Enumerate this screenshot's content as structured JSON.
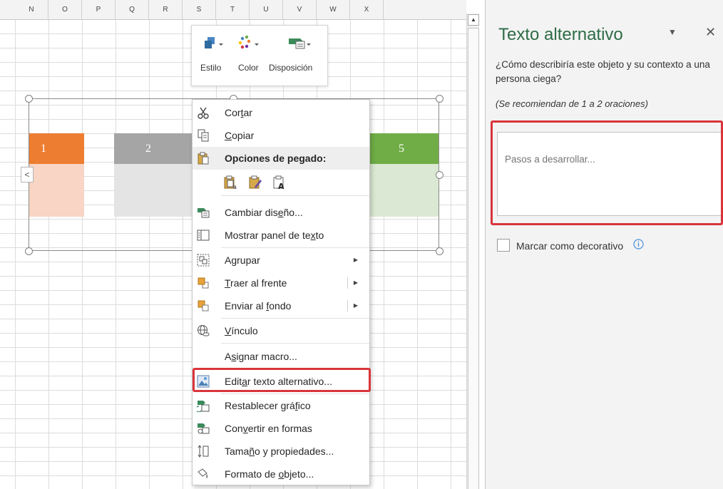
{
  "sheet": {
    "columns": [
      "N",
      "O",
      "P",
      "Q",
      "R",
      "S",
      "T",
      "U",
      "V",
      "W",
      "X"
    ]
  },
  "smartart": {
    "blocks": [
      {
        "label": "1",
        "color": "#ed7d31",
        "body_color": "#f8d5c4"
      },
      {
        "label": "2",
        "color": "#a5a5a5",
        "body_color": "#e4e4e4"
      },
      {
        "label": "5",
        "color": "#70ad47",
        "body_color": "#dbe8d3"
      }
    ],
    "expand_icon": "chevron-left-icon",
    "expand_glyph": "<"
  },
  "mini_toolbar": {
    "items": [
      {
        "label": "Estilo",
        "icon": "smartart-style-icon"
      },
      {
        "label": "Color",
        "icon": "smartart-color-icon"
      },
      {
        "label": "Disposición",
        "icon": "smartart-layout-icon"
      }
    ]
  },
  "context_menu": {
    "cut": {
      "before": "Cor",
      "mnemonic": "t",
      "after": "ar"
    },
    "copy": {
      "before": "",
      "mnemonic": "C",
      "after": "opiar"
    },
    "paste_options_header": "Opciones de pegado:",
    "change_layout": {
      "before": "Cambiar dis",
      "mnemonic": "e",
      "after": "ño..."
    },
    "text_pane": {
      "before": "Mostrar panel de te",
      "mnemonic": "x",
      "after": "to"
    },
    "group": {
      "before": "A",
      "mnemonic": "g",
      "after": "rupar"
    },
    "bring_front": {
      "before": "",
      "mnemonic": "T",
      "after": "raer al frente"
    },
    "send_back": {
      "before": "Enviar al ",
      "mnemonic": "f",
      "after": "ondo"
    },
    "link": {
      "before": "",
      "mnemonic": "V",
      "after": "ínculo"
    },
    "assign_macro": {
      "before": "A",
      "mnemonic": "s",
      "after": "ignar macro..."
    },
    "edit_alt_text": {
      "before": "Edit",
      "mnemonic": "a",
      "after": "r texto alternativo..."
    },
    "reset_graphic": {
      "before": "Restablecer grá",
      "mnemonic": "f",
      "after": "ico"
    },
    "convert_shapes": {
      "before": "Con",
      "mnemonic": "v",
      "after": "ertir en formas"
    },
    "size_props": {
      "before": "Tama",
      "mnemonic": "ñ",
      "after": "o y propiedades..."
    },
    "format_object": {
      "before": "Formato de ",
      "mnemonic": "o",
      "after": "bjeto..."
    }
  },
  "pane": {
    "title": "Texto alternativo",
    "dropdown_glyph": "▼",
    "close_glyph": "✕",
    "question": "¿Cómo describiría este objeto y su contexto a una persona ciega?",
    "hint": "(Se recomiendan de 1 a 2 oraciones)",
    "input_placeholder": "Pasos a desarrollar...",
    "input_value": "",
    "decorative_label": "Marcar como decorativo",
    "decorative_checked": false
  },
  "scrollbar": {
    "up_glyph": "▲"
  },
  "colors": {
    "accent_title": "#2e6b47",
    "highlight_red": "#d9343b"
  }
}
